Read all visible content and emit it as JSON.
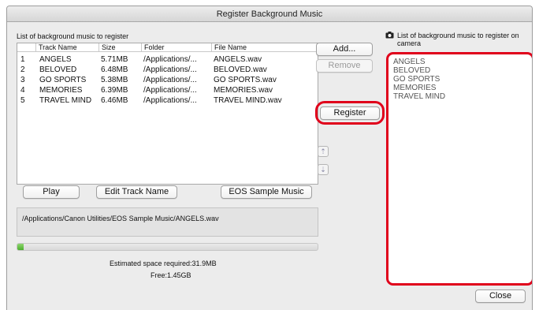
{
  "window": {
    "title": "Register Background Music"
  },
  "left": {
    "section_label": "List of background music to register",
    "columns": [
      "Track Name",
      "Size",
      "Folder",
      "File Name"
    ],
    "rows": [
      {
        "num": "1",
        "track": "ANGELS",
        "size": "5.71MB",
        "folder": "/Applications/...",
        "file": "ANGELS.wav"
      },
      {
        "num": "2",
        "track": "BELOVED",
        "size": "6.48MB",
        "folder": "/Applications/...",
        "file": "BELOVED.wav"
      },
      {
        "num": "3",
        "track": "GO SPORTS",
        "size": "5.38MB",
        "folder": "/Applications/...",
        "file": "GO SPORTS.wav"
      },
      {
        "num": "4",
        "track": "MEMORIES",
        "size": "6.39MB",
        "folder": "/Applications/...",
        "file": "MEMORIES.wav"
      },
      {
        "num": "5",
        "track": "TRAVEL MIND",
        "size": "6.46MB",
        "folder": "/Applications/...",
        "file": "TRAVEL MIND.wav"
      }
    ],
    "buttons": {
      "play": "Play",
      "edit": "Edit Track Name",
      "eos": "EOS Sample Music"
    },
    "path": "/Applications/Canon Utilities/EOS Sample Music/ANGELS.wav",
    "progress_fraction": 0.02,
    "space_required": "Estimated space required:31.9MB",
    "free": "Free:1.45GB"
  },
  "middle": {
    "add": "Add...",
    "remove": "Remove",
    "register": "Register"
  },
  "right": {
    "section_label_line1": "List of background music to register on",
    "section_label_line2": "camera",
    "items": [
      "ANGELS",
      "BELOVED",
      "GO SPORTS",
      "MEMORIES",
      "TRAVEL MIND"
    ]
  },
  "footer": {
    "close": "Close"
  },
  "colors": {
    "highlight": "#e0001b",
    "progress": "#4caf2e"
  },
  "icons": {
    "camera": "camera-icon",
    "up": "move-up-icon",
    "down": "move-down-icon"
  }
}
